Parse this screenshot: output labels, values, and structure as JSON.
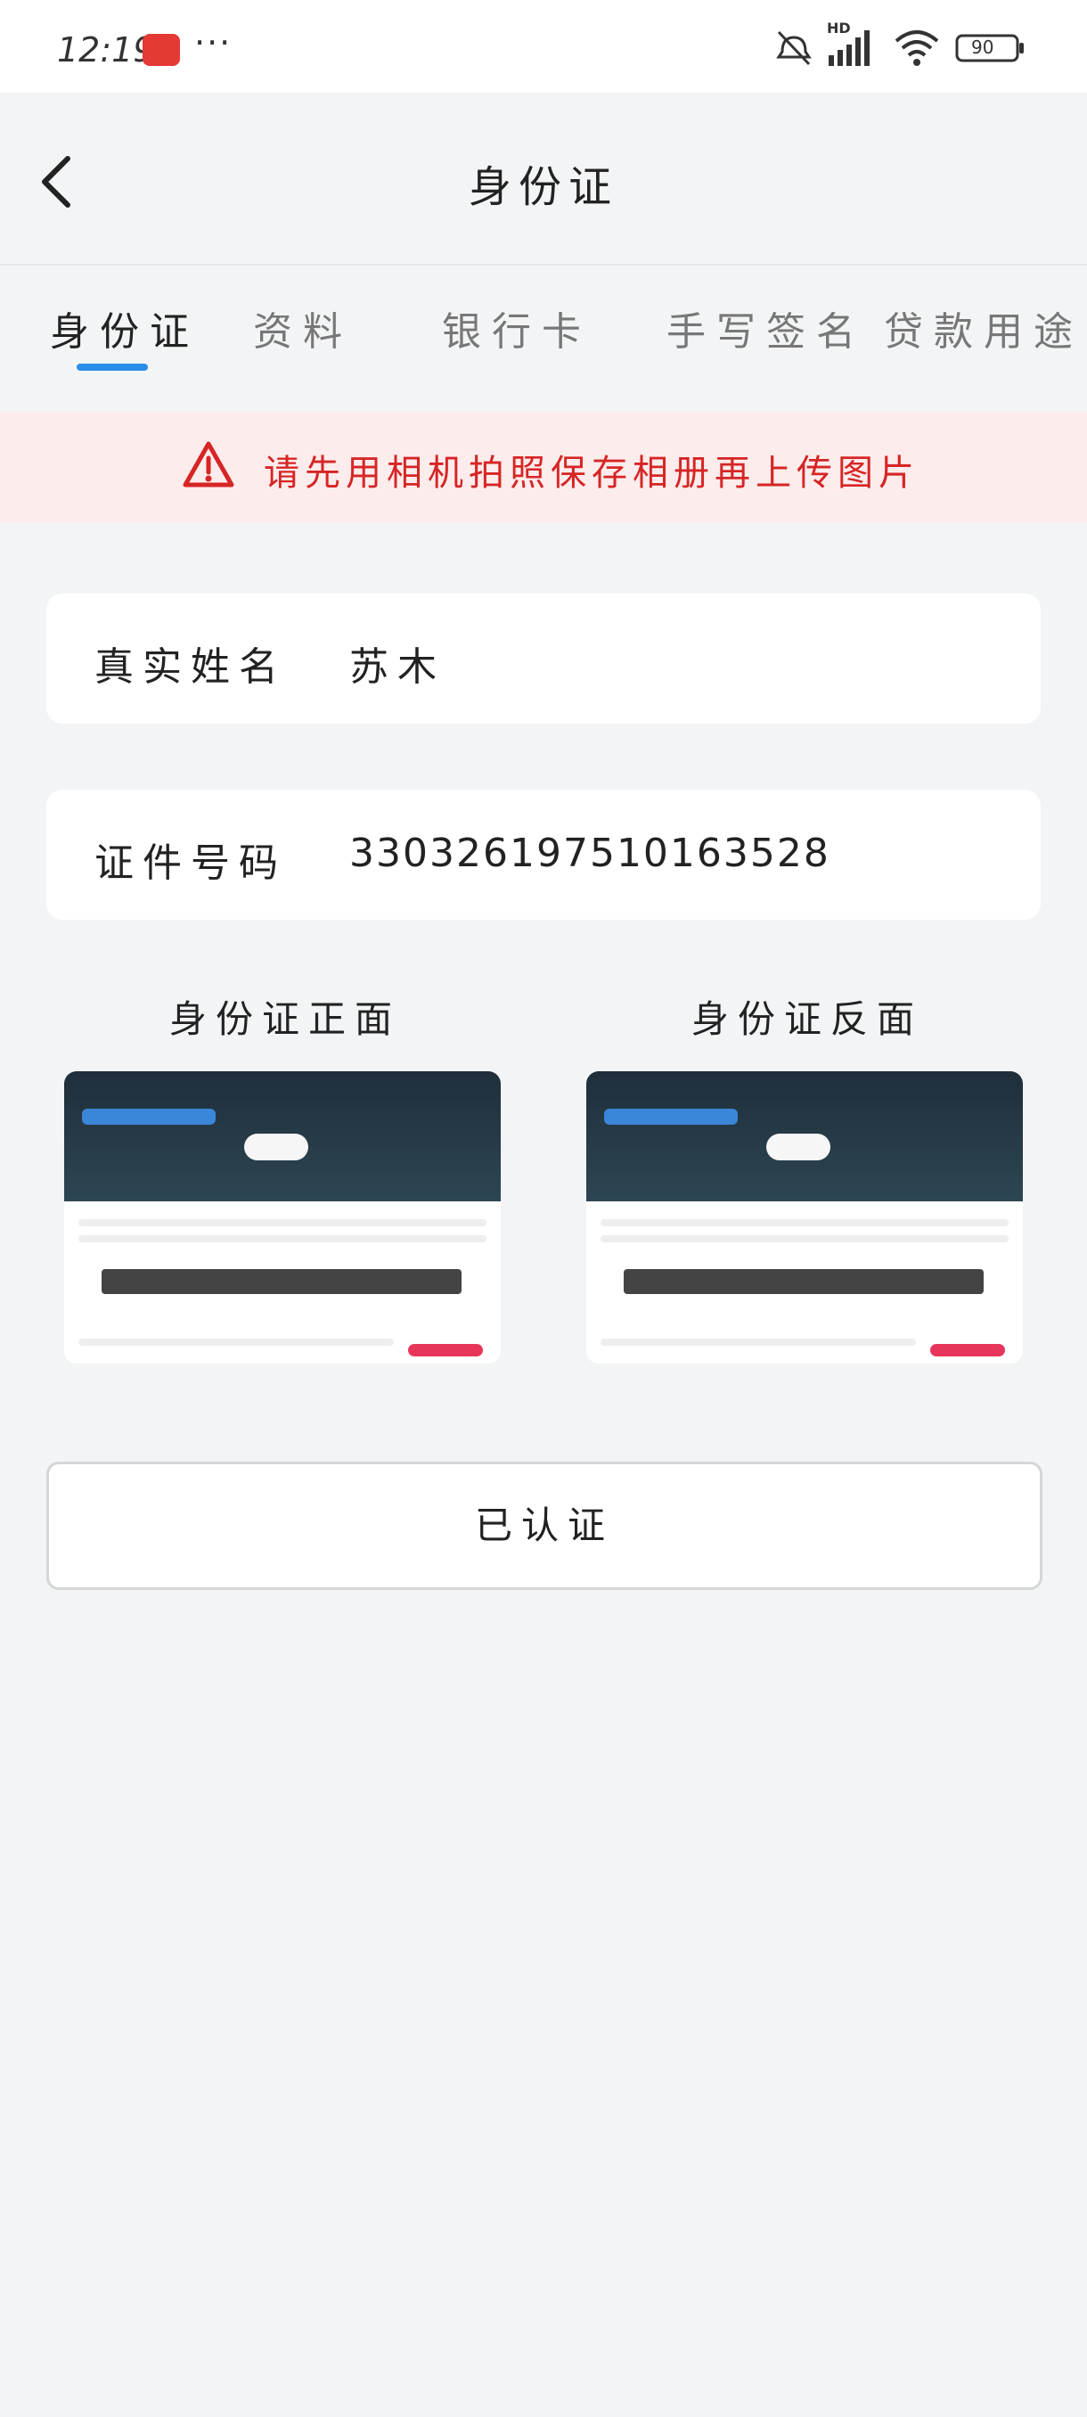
{
  "status_bar": {
    "time": "12:19",
    "more_dots": "···",
    "network_label": "HD",
    "battery_level": "90"
  },
  "header": {
    "title": "身份证"
  },
  "tabs": [
    {
      "label": "身份证"
    },
    {
      "label": "资料"
    },
    {
      "label": "银行卡"
    },
    {
      "label": "手写签名"
    },
    {
      "label": "贷款用途"
    }
  ],
  "notice": {
    "text": "请先用相机拍照保存相册再上传图片",
    "color": "#d62525"
  },
  "form": {
    "name_label": "真实姓名",
    "name_value": "苏木",
    "id_label": "证件号码",
    "id_value": "330326197510163528"
  },
  "photos": {
    "front_title": "身份证正面",
    "back_title": "身份证反面"
  },
  "action": {
    "verified_label": "已认证"
  },
  "colors": {
    "accent": "#2b8de8",
    "background": "#f3f4f6",
    "notice_bg": "#fdecec"
  }
}
